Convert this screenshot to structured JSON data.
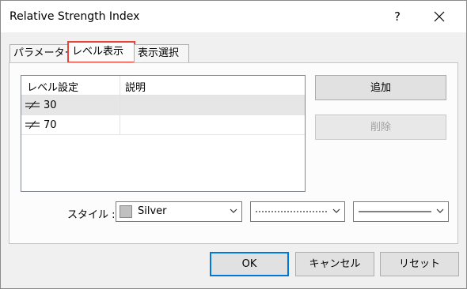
{
  "window": {
    "title": "Relative Strength Index",
    "help_label": "?",
    "close_label": "✕"
  },
  "tabs": [
    {
      "label": "パラメーター"
    },
    {
      "label": "レベル表示"
    },
    {
      "label": "表示選択"
    }
  ],
  "levels": {
    "headers": {
      "level": "レベル設定",
      "description": "説明"
    },
    "rows": [
      {
        "value": "30",
        "description": ""
      },
      {
        "value": "70",
        "description": ""
      }
    ]
  },
  "buttons": {
    "add": "追加",
    "delete": "削除"
  },
  "style": {
    "label": "スタイル :",
    "color_name": "Silver",
    "color_hex": "#c0c0c0",
    "line_style": "dotted",
    "line_width": "solid"
  },
  "footer": {
    "ok": "OK",
    "cancel": "キャンセル",
    "reset": "リセット"
  }
}
